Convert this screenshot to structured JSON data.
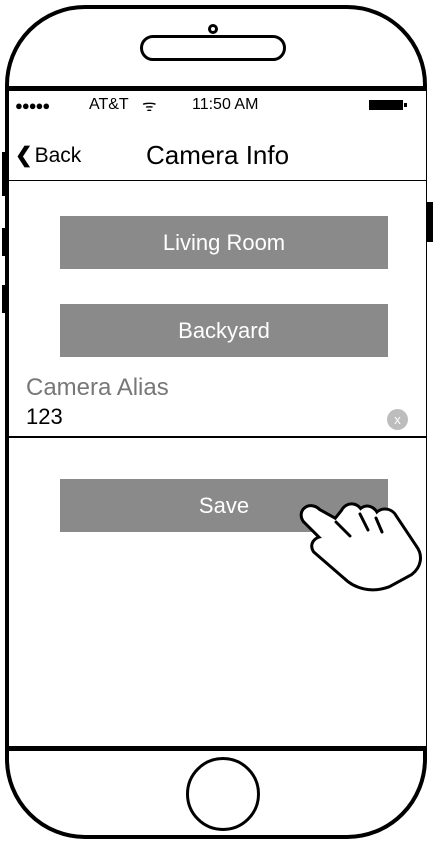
{
  "status": {
    "signal": "●●●●●",
    "carrier": "AT&T",
    "wifi": "ᯤ",
    "time": "11:50  AM"
  },
  "nav": {
    "back_label": "Back",
    "back_chevron": "❮",
    "title": "Camera Info"
  },
  "cameras": [
    {
      "label": "Living Room"
    },
    {
      "label": "Backyard"
    }
  ],
  "alias": {
    "label": "Camera Alias",
    "value": "123",
    "clear_icon": "x"
  },
  "save_label": "Save",
  "colors": {
    "button_gray": "#8a8a8a",
    "label_gray": "#777777",
    "clear_gray": "#bdbdbd"
  }
}
